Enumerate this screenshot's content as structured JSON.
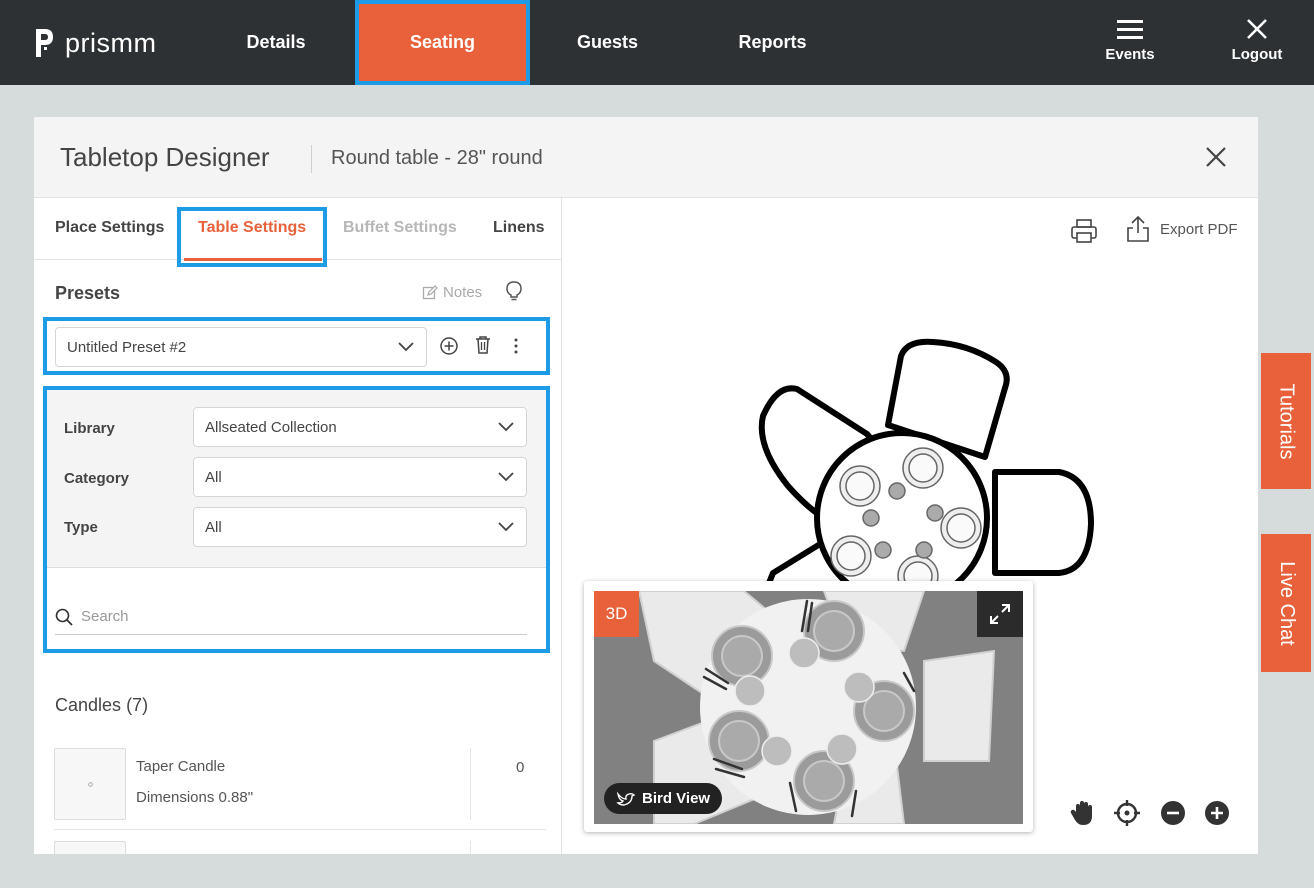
{
  "brand": {
    "name": "prismm"
  },
  "nav": {
    "items": [
      "Details",
      "Seating",
      "Guests",
      "Reports"
    ],
    "active": "Seating",
    "events_label": "Events",
    "logout_label": "Logout"
  },
  "modal": {
    "title": "Tabletop Designer",
    "subtitle": "Round table - 28\" round"
  },
  "tabs": [
    "Place Settings",
    "Table Settings",
    "Buffet Settings",
    "Linens"
  ],
  "presets": {
    "title": "Presets",
    "notes_label": "Notes",
    "selected": "Untitled Preset #2"
  },
  "filters": {
    "library_label": "Library",
    "library_value": "Allseated Collection",
    "category_label": "Category",
    "category_value": "All",
    "type_label": "Type",
    "type_value": "All",
    "search_placeholder": "Search"
  },
  "candles": {
    "title": "Candles",
    "count": "(7)",
    "items": [
      {
        "name": "Taper Candle",
        "dimensions": "Dimensions 0.88\"",
        "qty": "0"
      }
    ]
  },
  "preview": {
    "export_label": "Export PDF",
    "badge_3d": "3D",
    "bird_view_label": "Bird View"
  },
  "side_tabs": {
    "tutorials": "Tutorials",
    "live_chat": "Live Chat"
  },
  "colors": {
    "accent": "#e8613a",
    "topbar": "#2e3133",
    "highlight": "#1e9be6"
  }
}
